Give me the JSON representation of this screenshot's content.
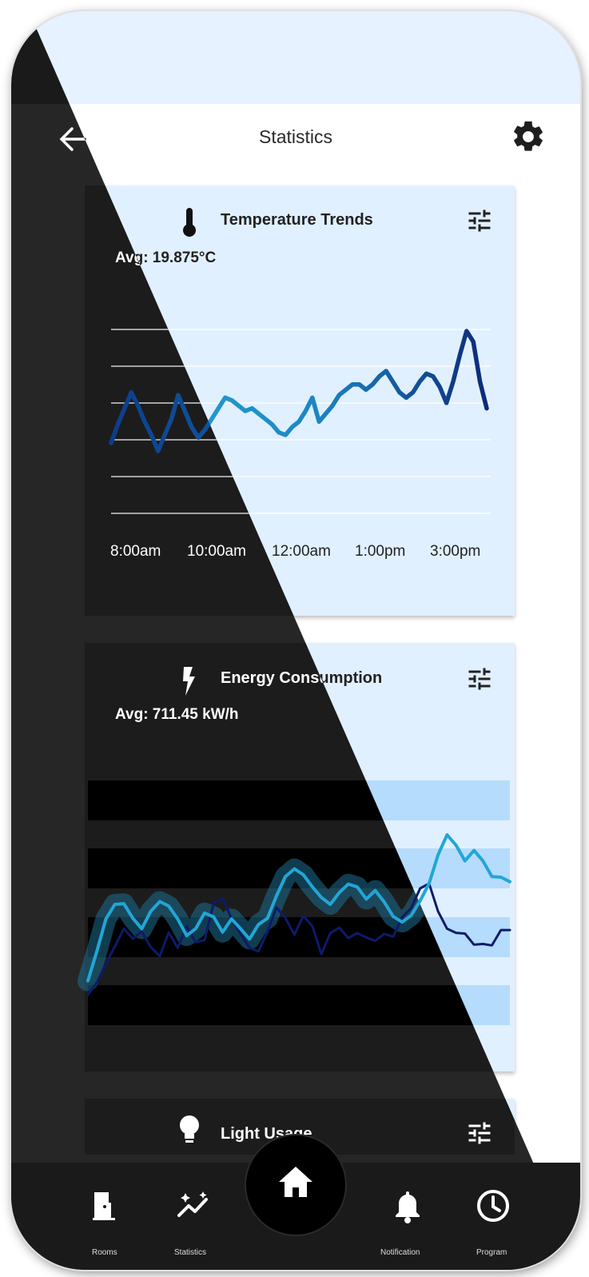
{
  "header": {
    "title": "Statistics",
    "back_icon": "arrow-left-icon",
    "settings_icon": "gear-icon"
  },
  "temperature_card": {
    "title": "Temperature Trends",
    "icon": "thermometer-icon",
    "filter_icon": "tune-icon",
    "avg": "Avg: 19.875°C",
    "chart_data": {
      "type": "line",
      "x_tick_labels": [
        "8:00am",
        "10:00am",
        "12:00am",
        "1:00pm",
        "3:00pm"
      ],
      "grid": true,
      "series": [
        {
          "values": [
            18.7,
            19.4,
            20.0,
            20.6,
            20.1,
            19.5,
            19.0,
            18.4,
            19.0,
            19.6,
            20.5,
            19.9,
            19.3,
            18.9,
            19.2,
            19.6,
            20.0,
            20.4,
            20.3,
            20.1,
            19.9,
            20.0,
            19.8,
            19.6,
            19.4,
            19.1,
            19.0,
            19.3,
            19.5,
            19.9,
            20.4,
            19.5,
            19.8,
            20.1,
            20.5,
            20.7,
            20.9,
            20.9,
            20.7,
            20.9,
            21.2,
            21.4,
            21.0,
            20.6,
            20.4,
            20.6,
            21.0,
            21.3,
            21.2,
            20.8,
            20.2,
            21.0,
            22.0,
            22.9,
            22.5,
            21.0,
            20.0
          ]
        }
      ]
    }
  },
  "energy_card": {
    "title": "Energy Consumption",
    "icon": "lightning-icon",
    "filter_icon": "tune-icon",
    "avg": "Avg: 711.45 kW/h",
    "chart_data": {
      "type": "line",
      "series": [
        {
          "values": [
            420,
            505,
            598,
            640,
            642,
            600,
            570,
            620,
            648,
            635,
            598,
            550,
            570,
            615,
            604,
            560,
            598,
            570,
            540,
            582,
            600,
            664,
            720,
            742,
            725,
            690,
            660,
            640,
            674,
            698,
            690,
            655,
            680,
            647,
            605,
            589,
            608,
            650,
            700,
            782,
            840,
            810,
            765,
            795,
            765,
            720,
            718,
            705
          ]
        },
        {
          "values": [
            380,
            415,
            469,
            519,
            570,
            541,
            561,
            517,
            491,
            559,
            515,
            577,
            531,
            537,
            643,
            657,
            599,
            555,
            515,
            505,
            561,
            631,
            601,
            553,
            607,
            577,
            497,
            557,
            573,
            543,
            557,
            545,
            535,
            555,
            547,
            603,
            629,
            686,
            700,
            620,
            570,
            558,
            556,
            524,
            526,
            522,
            566,
            566
          ]
        }
      ]
    }
  },
  "light_card": {
    "title": "Light Usage",
    "icon": "lightbulb-icon",
    "filter_icon": "tune-icon"
  },
  "bottom_nav": {
    "items": [
      {
        "label": "Rooms",
        "icon": "door-icon"
      },
      {
        "label": "Statistics",
        "icon": "sparkle-trend-icon"
      },
      {
        "label": "",
        "icon": "home-icon"
      },
      {
        "label": "Notification",
        "icon": "bell-icon"
      },
      {
        "label": "Program",
        "icon": "clock-icon"
      }
    ]
  }
}
